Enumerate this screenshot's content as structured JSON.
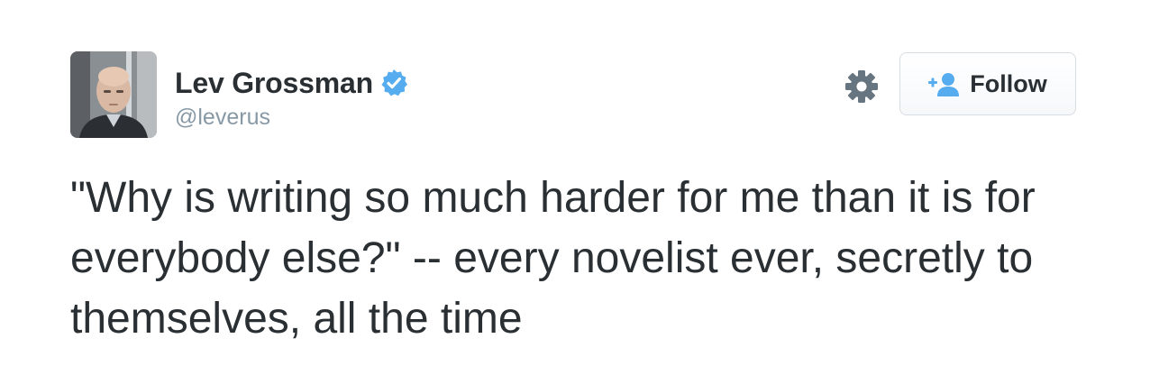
{
  "author": {
    "name": "Lev Grossman",
    "handle": "@leverus",
    "verified": true,
    "avatar_icon": "user-photo"
  },
  "actions": {
    "settings_icon": "gear-icon",
    "follow_label": "Follow",
    "follow_icon": "add-user-icon"
  },
  "tweet": {
    "text": "\"Why is writing so much harder for me than it is for everybody else?\" -- every novelist ever, secretly to themselves, all the time"
  },
  "colors": {
    "text": "#292f33",
    "secondary": "#8899a6",
    "verified": "#1da1f2",
    "accent": "#55acee",
    "icon": "#66757f"
  }
}
